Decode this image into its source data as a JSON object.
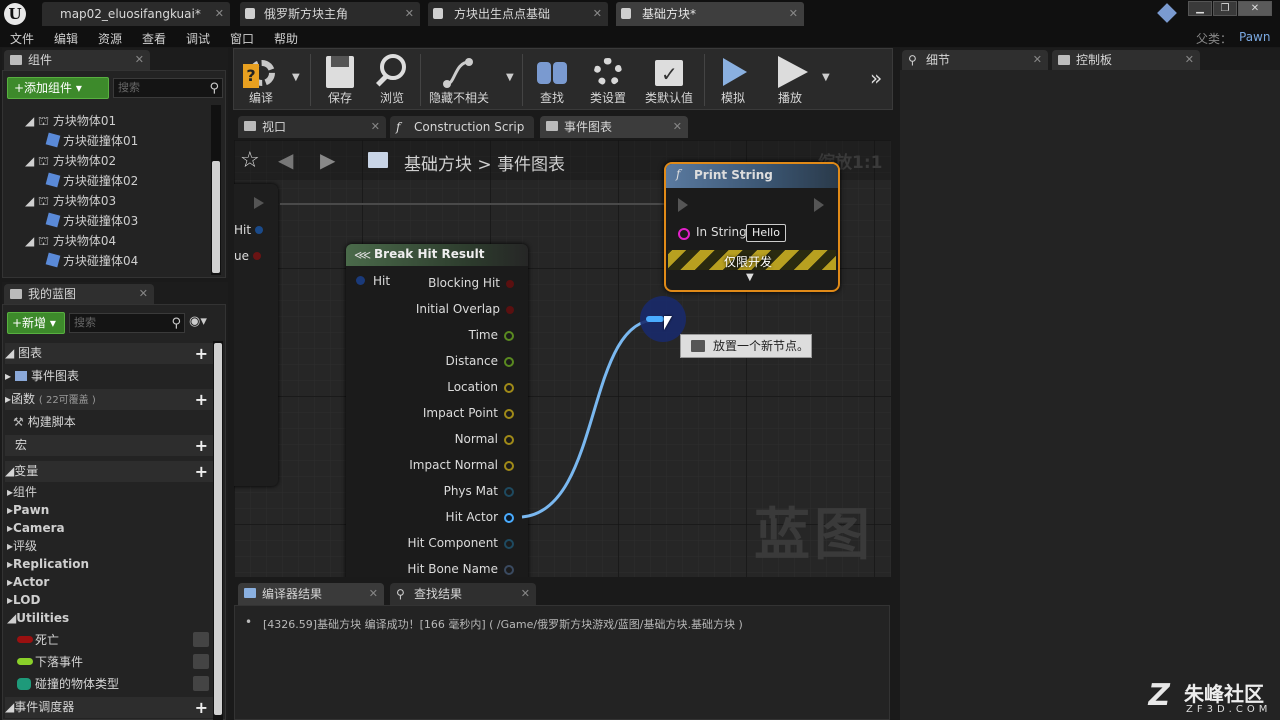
{
  "title_bar": {
    "tabs": [
      {
        "label": "map02_eluosifangkuai*"
      },
      {
        "label": "俄罗斯方块主角"
      },
      {
        "label": "方块出生点点基础"
      },
      {
        "label": "基础方块*"
      }
    ]
  },
  "menu": {
    "items": [
      "文件",
      "编辑",
      "资源",
      "查看",
      "调试",
      "窗口",
      "帮助"
    ],
    "parent_label": "父类：",
    "parent_value": "Pawn"
  },
  "components_panel": {
    "tab_label": "组件",
    "add_button": "+添加组件",
    "search_placeholder": "搜索",
    "tree": [
      {
        "label": "方块物体01",
        "type": "actor"
      },
      {
        "label": "方块碰撞体01",
        "type": "mesh"
      },
      {
        "label": "方块物体02",
        "type": "actor"
      },
      {
        "label": "方块碰撞体02",
        "type": "mesh"
      },
      {
        "label": "方块物体03",
        "type": "actor"
      },
      {
        "label": "方块碰撞体03",
        "type": "mesh"
      },
      {
        "label": "方块物体04",
        "type": "actor"
      },
      {
        "label": "方块碰撞体04",
        "type": "mesh"
      }
    ]
  },
  "my_blueprint": {
    "tab_label": "我的蓝图",
    "new_button": "+新增",
    "search_placeholder": "搜索",
    "sections": {
      "graphs": "图表",
      "event_graph": "事件图表",
      "functions": "函数",
      "functions_note": "( 22可覆盖 )",
      "construction": "构建脚本",
      "macros": "宏",
      "variables": "变量",
      "dispatchers": "事件调度器"
    },
    "categories": [
      "组件",
      "Pawn",
      "Camera",
      "评级",
      "Replication",
      "Actor",
      "LOD",
      "Utilities"
    ],
    "variables": [
      {
        "label": "死亡",
        "color": "#9a1010"
      },
      {
        "label": "下落事件",
        "color": "#8ad02a"
      },
      {
        "label": "碰撞的物体类型",
        "color": "#1e9a7a"
      }
    ]
  },
  "toolbar": {
    "buttons": [
      "编译",
      "保存",
      "浏览",
      "隐藏不相关",
      "查找",
      "类设置",
      "类默认值",
      "模拟",
      "播放"
    ]
  },
  "editor_tabs": [
    "视口",
    "Construction Scrip",
    "事件图表"
  ],
  "graph": {
    "breadcrumb_root": "基础方块",
    "breadcrumb_sep": ">",
    "breadcrumb_current": "事件图表",
    "zoom": "缩放1:1",
    "watermark": "蓝图",
    "left_node_pins": [
      "Hit",
      "ue"
    ],
    "break_node": {
      "title": "Break Hit Result",
      "input": "Hit",
      "outputs": [
        {
          "label": "Blocking Hit",
          "color": "#8a1a1a"
        },
        {
          "label": "Initial Overlap",
          "color": "#8a1a1a"
        },
        {
          "label": "Time",
          "color": "#7ab030"
        },
        {
          "label": "Distance",
          "color": "#7ab030"
        },
        {
          "label": "Location",
          "color": "#d8b020"
        },
        {
          "label": "Impact Point",
          "color": "#d8b020"
        },
        {
          "label": "Normal",
          "color": "#d8b020"
        },
        {
          "label": "Impact Normal",
          "color": "#d8b020"
        },
        {
          "label": "Phys Mat",
          "color": "#2a6a8a"
        },
        {
          "label": "Hit Actor",
          "color": "#40a8ff"
        },
        {
          "label": "Hit Component",
          "color": "#2a6a8a"
        },
        {
          "label": "Hit Bone Name",
          "color": "#5a7aa0"
        }
      ]
    },
    "print_node": {
      "title": "Print String",
      "in_string_label": "In String",
      "in_string_value": "Hello",
      "dev_only": "仅限开发"
    },
    "tooltip": "放置一个新节点。"
  },
  "bottom": {
    "tabs": [
      "编译器结果",
      "查找结果"
    ],
    "log": "[4326.59]基础方块 编译成功！[166 毫秒内] ( /Game/俄罗斯方块游戏/蓝图/基础方块.基础方块 )"
  },
  "right_tabs": [
    "细节",
    "控制板"
  ],
  "corner_logo": {
    "text": "朱峰社区",
    "sub": "ZF3D.COM"
  }
}
